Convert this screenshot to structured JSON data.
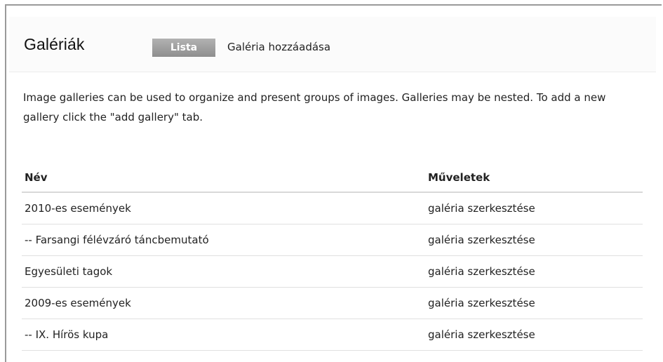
{
  "header": {
    "title": "Galériák",
    "tabs": [
      {
        "label": "Lista",
        "active": true
      },
      {
        "label": "Galéria hozzáadása",
        "active": false
      }
    ]
  },
  "description": "Image galleries can be used to organize and present groups of images. Galleries may be nested. To add a new gallery click the \"add gallery\" tab.",
  "table": {
    "columns": [
      "Név",
      "Műveletek"
    ],
    "rows": [
      {
        "name": "2010-es események",
        "action": "galéria szerkesztése"
      },
      {
        "name": "-- Farsangi félévzáró táncbemutató",
        "action": "galéria szerkesztése"
      },
      {
        "name": "Egyesületi tagok",
        "action": "galéria szerkesztése"
      },
      {
        "name": "2009-es események",
        "action": "galéria szerkesztése"
      },
      {
        "name": "-- IX. Hírös kupa",
        "action": "galéria szerkesztése"
      }
    ]
  },
  "colors": {
    "frame_border": "#9a9a9a",
    "tab_active_bg": "#9e9e9e",
    "tab_active_text": "#ffffff",
    "row_divider": "#e0e0e0"
  }
}
